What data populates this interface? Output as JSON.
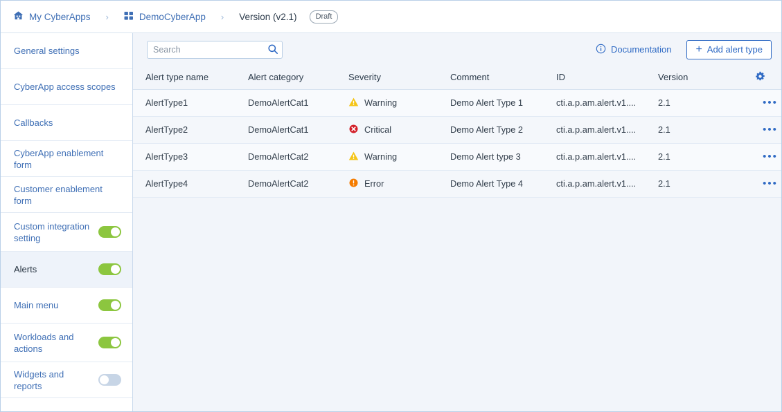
{
  "breadcrumb": {
    "home_label": "My CyberApps",
    "app_label": "DemoCyberApp",
    "version_label": "Version (v2.1)",
    "status_badge": "Draft",
    "separator": "›"
  },
  "sidebar": {
    "items": [
      {
        "label": "General settings",
        "active": false,
        "toggle": null
      },
      {
        "label": "CyberApp access scopes",
        "active": false,
        "toggle": null
      },
      {
        "label": "Callbacks",
        "active": false,
        "toggle": null
      },
      {
        "label": "CyberApp enablement form",
        "active": false,
        "toggle": null
      },
      {
        "label": "Customer enablement form",
        "active": false,
        "toggle": null
      },
      {
        "label": "Custom integration setting",
        "active": false,
        "toggle": "on"
      },
      {
        "label": "Alerts",
        "active": true,
        "toggle": "on"
      },
      {
        "label": "Main menu",
        "active": false,
        "toggle": "on"
      },
      {
        "label": "Workloads and actions",
        "active": false,
        "toggle": "on"
      },
      {
        "label": "Widgets and reports",
        "active": false,
        "toggle": "off"
      }
    ]
  },
  "toolbar": {
    "search_placeholder": "Search",
    "search_value": "",
    "documentation_label": "Documentation",
    "add_button_label": "Add alert type",
    "add_button_plus": "+"
  },
  "table": {
    "columns": [
      "Alert type name",
      "Alert category",
      "Severity",
      "Comment",
      "ID",
      "Version"
    ],
    "rows": [
      {
        "name": "AlertType1",
        "category": "DemoAlertCat1",
        "severity": "Warning",
        "severity_icon": "warning-triangle-icon",
        "comment": "Demo Alert Type 1",
        "id": "cti.a.p.am.alert.v1....",
        "version": "2.1",
        "actions": "•••"
      },
      {
        "name": "AlertType2",
        "category": "DemoAlertCat1",
        "severity": "Critical",
        "severity_icon": "critical-circle-x-icon",
        "comment": "Demo Alert Type 2",
        "id": "cti.a.p.am.alert.v1....",
        "version": "2.1",
        "actions": "•••"
      },
      {
        "name": "AlertType3",
        "category": "DemoAlertCat2",
        "severity": "Warning",
        "severity_icon": "warning-triangle-icon",
        "comment": "Demo Alert type 3",
        "id": "cti.a.p.am.alert.v1....",
        "version": "2.1",
        "actions": "•••"
      },
      {
        "name": "AlertType4",
        "category": "DemoAlertCat2",
        "severity": "Error",
        "severity_icon": "error-circle-exclamation-icon",
        "comment": "Demo Alert Type 4",
        "id": "cti.a.p.am.alert.v1....",
        "version": "2.1",
        "actions": "•••"
      }
    ]
  },
  "colors": {
    "accent_blue": "#2f6ac4",
    "link_blue": "#3f6fb5",
    "toggle_on_green": "#8cc63f",
    "toggle_off_gray": "#c7d5e6",
    "warning_yellow": "#f5c518",
    "critical_red": "#d32029",
    "error_orange": "#f57c00",
    "page_bg": "#f2f5fa"
  }
}
